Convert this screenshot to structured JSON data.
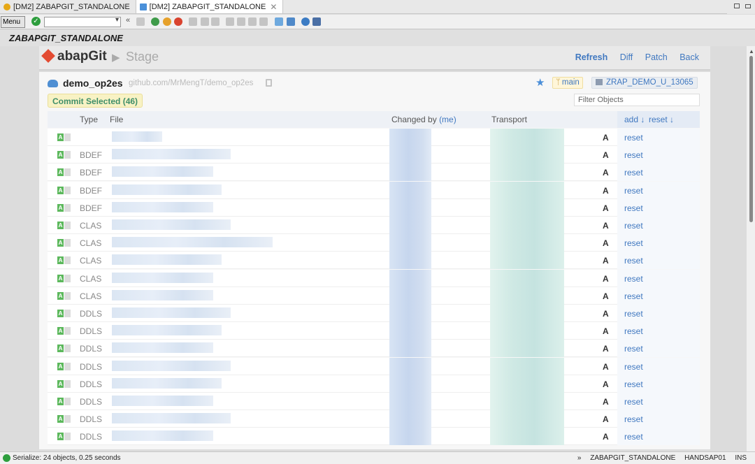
{
  "window": {
    "tabs": [
      {
        "label": "[DM2] ZABAPGIT_STANDALONE",
        "active": false
      },
      {
        "label": "[DM2] ZABAPGIT_STANDALONE",
        "active": true
      }
    ]
  },
  "toolbar": {
    "menu_label": "Menu"
  },
  "title": "ZABAPGIT_STANDALONE",
  "header": {
    "logo_text": "abapGit",
    "page": "Stage",
    "links": [
      "Refresh",
      "Diff",
      "Patch",
      "Back"
    ]
  },
  "repo": {
    "name": "demo_op2es",
    "url": "github.com/MrMengT/demo_op2es",
    "branch": "main",
    "package": "ZRAP_DEMO_U_13065"
  },
  "commit_button": "Commit Selected (46)",
  "filter_placeholder": "Filter Objects",
  "table": {
    "headers": {
      "type": "Type",
      "file": "File",
      "changed_by": "Changed by",
      "me": "(me)",
      "transport": "Transport",
      "add": "add ↓",
      "reset": "reset ↓"
    },
    "rows": [
      {
        "type": "",
        "state": "A",
        "action": "reset"
      },
      {
        "type": "BDEF",
        "state": "A",
        "action": "reset"
      },
      {
        "type": "BDEF",
        "state": "A",
        "action": "reset"
      },
      {
        "type": "BDEF",
        "state": "A",
        "action": "reset"
      },
      {
        "type": "BDEF",
        "state": "A",
        "action": "reset"
      },
      {
        "type": "CLAS",
        "state": "A",
        "action": "reset"
      },
      {
        "type": "CLAS",
        "state": "A",
        "action": "reset"
      },
      {
        "type": "CLAS",
        "state": "A",
        "action": "reset"
      },
      {
        "type": "CLAS",
        "state": "A",
        "action": "reset"
      },
      {
        "type": "CLAS",
        "state": "A",
        "action": "reset"
      },
      {
        "type": "DDLS",
        "state": "A",
        "action": "reset"
      },
      {
        "type": "DDLS",
        "state": "A",
        "action": "reset"
      },
      {
        "type": "DDLS",
        "state": "A",
        "action": "reset"
      },
      {
        "type": "DDLS",
        "state": "A",
        "action": "reset"
      },
      {
        "type": "DDLS",
        "state": "A",
        "action": "reset"
      },
      {
        "type": "DDLS",
        "state": "A",
        "action": "reset"
      },
      {
        "type": "DDLS",
        "state": "A",
        "action": "reset"
      },
      {
        "type": "DDLS",
        "state": "A",
        "action": "reset"
      }
    ]
  },
  "status": {
    "message": "Serialize: 24 objects, 0.25 seconds",
    "program": "ZABAPGIT_STANDALONE",
    "host": "HANDSAP01",
    "mode": "INS"
  }
}
